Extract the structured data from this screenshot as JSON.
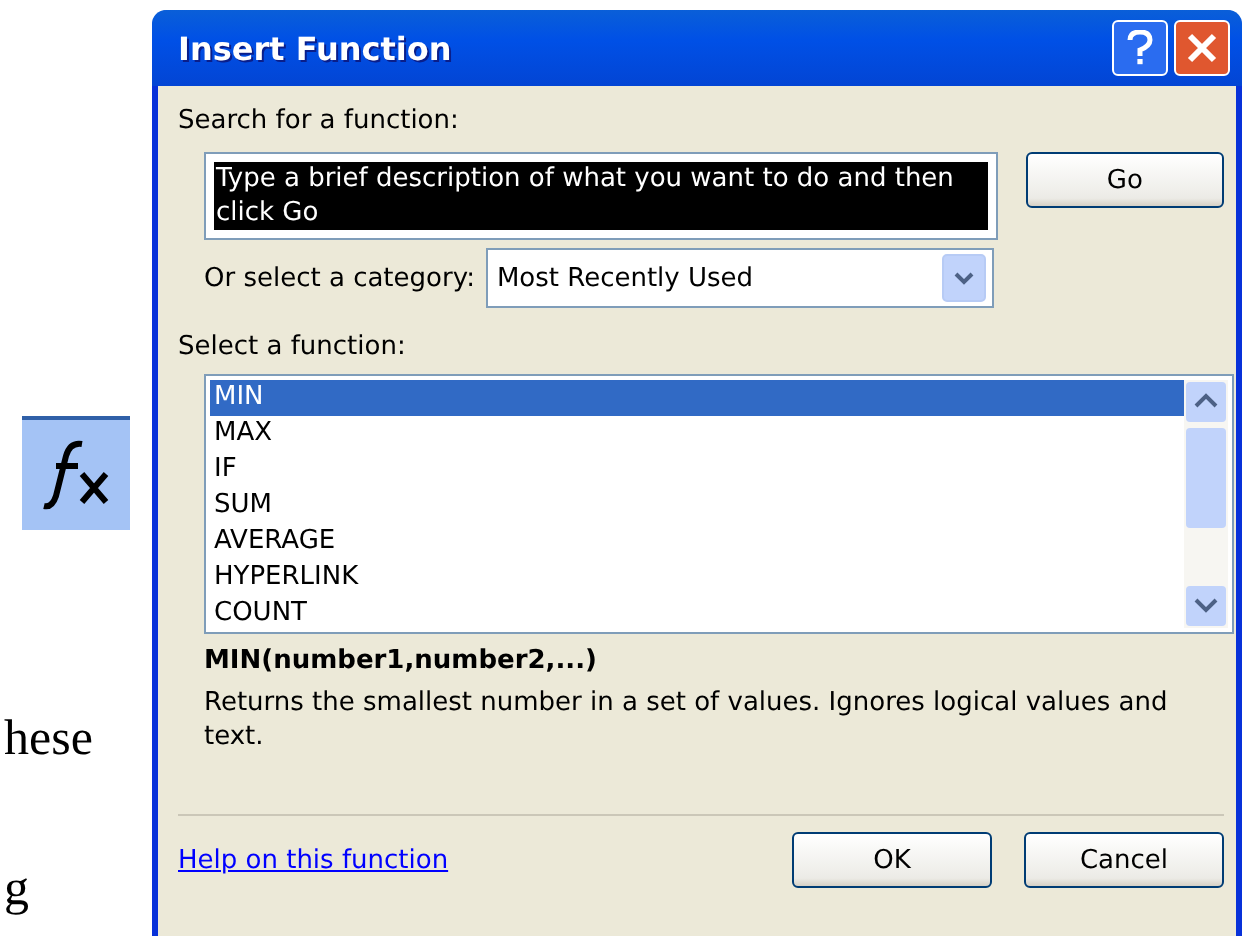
{
  "background": {
    "texts": [
      "hese",
      "g"
    ]
  },
  "window": {
    "title": "Insert Function"
  },
  "search": {
    "label": "Search for a function:",
    "value": "Type a brief description of what you want to do and then click Go",
    "button": "Go"
  },
  "category": {
    "label": "Or select a category:",
    "value": "Most Recently Used"
  },
  "functions": {
    "label": "Select a function:",
    "items": [
      {
        "name": "MIN",
        "selected": true
      },
      {
        "name": "MAX",
        "selected": false
      },
      {
        "name": "IF",
        "selected": false
      },
      {
        "name": "SUM",
        "selected": false
      },
      {
        "name": "AVERAGE",
        "selected": false
      },
      {
        "name": "HYPERLINK",
        "selected": false
      },
      {
        "name": "COUNT",
        "selected": false
      }
    ]
  },
  "signature": "MIN(number1,number2,...)",
  "description": "Returns the smallest number in a set of values. Ignores logical values and text.",
  "help_link": "Help on this function",
  "buttons": [
    "OK",
    "Cancel"
  ]
}
